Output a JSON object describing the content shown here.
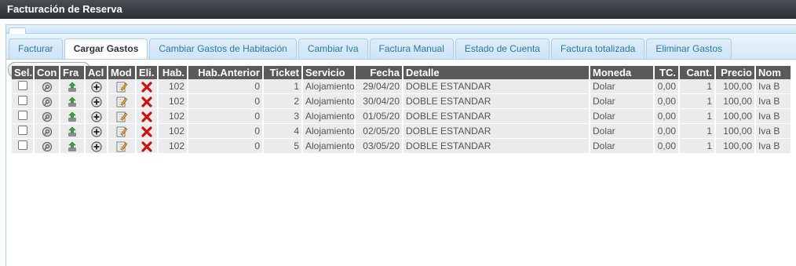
{
  "title": "Facturación de Reserva",
  "tabs": [
    {
      "label": "Facturar",
      "active": false
    },
    {
      "label": "Cargar Gastos",
      "active": true
    },
    {
      "label": "Cambiar Gastos de Habitación",
      "active": false
    },
    {
      "label": "Cambiar Iva",
      "active": false
    },
    {
      "label": "Factura Manual",
      "active": false
    },
    {
      "label": "Estado de Cuenta",
      "active": false
    },
    {
      "label": "Factura totalizada",
      "active": false
    },
    {
      "label": "Eliminar Gastos",
      "active": false
    }
  ],
  "toolbar": {
    "cargar_label": "Cargar Gastos"
  },
  "grid": {
    "columns": [
      "Sel.",
      "Con",
      "Fra",
      "Acl",
      "Mod",
      "Eli.",
      "Hab.",
      "Hab.Anterior",
      "Ticket",
      "Servicio",
      "Fecha",
      "Detalle",
      "Moneda",
      "TC.",
      "Cant.",
      "Precio",
      "Nom"
    ],
    "rows": [
      {
        "hab": "102",
        "hab_anterior": "0",
        "ticket": "1",
        "servicio": "Alojamiento",
        "fecha": "29/04/20",
        "detalle": "DOBLE ESTANDAR",
        "moneda": "Dolar",
        "tc": "0,00",
        "cant": "1",
        "precio": "100,00",
        "nom": "Iva B"
      },
      {
        "hab": "102",
        "hab_anterior": "0",
        "ticket": "2",
        "servicio": "Alojamiento",
        "fecha": "30/04/20",
        "detalle": "DOBLE ESTANDAR",
        "moneda": "Dolar",
        "tc": "0,00",
        "cant": "1",
        "precio": "100,00",
        "nom": "Iva B"
      },
      {
        "hab": "102",
        "hab_anterior": "0",
        "ticket": "3",
        "servicio": "Alojamiento",
        "fecha": "01/05/20",
        "detalle": "DOBLE ESTANDAR",
        "moneda": "Dolar",
        "tc": "0,00",
        "cant": "1",
        "precio": "100,00",
        "nom": "Iva B"
      },
      {
        "hab": "102",
        "hab_anterior": "0",
        "ticket": "4",
        "servicio": "Alojamiento",
        "fecha": "02/05/20",
        "detalle": "DOBLE ESTANDAR",
        "moneda": "Dolar",
        "tc": "0,00",
        "cant": "1",
        "precio": "100,00",
        "nom": "Iva B"
      },
      {
        "hab": "102",
        "hab_anterior": "0",
        "ticket": "5",
        "servicio": "Alojamiento",
        "fecha": "03/05/20",
        "detalle": "DOBLE ESTANDAR",
        "moneda": "Dolar",
        "tc": "0,00",
        "cant": "1",
        "precio": "100,00",
        "nom": "Iva B"
      }
    ],
    "row_icons": [
      "checkbox",
      "magnifier-icon",
      "split-icon",
      "add-circle-icon",
      "edit-icon",
      "delete-icon"
    ]
  },
  "colors": {
    "header_bg": "#5a5a5a",
    "row_bg": "#ebebeb",
    "tab_text": "#2779aa",
    "delete": "#cc1111"
  }
}
